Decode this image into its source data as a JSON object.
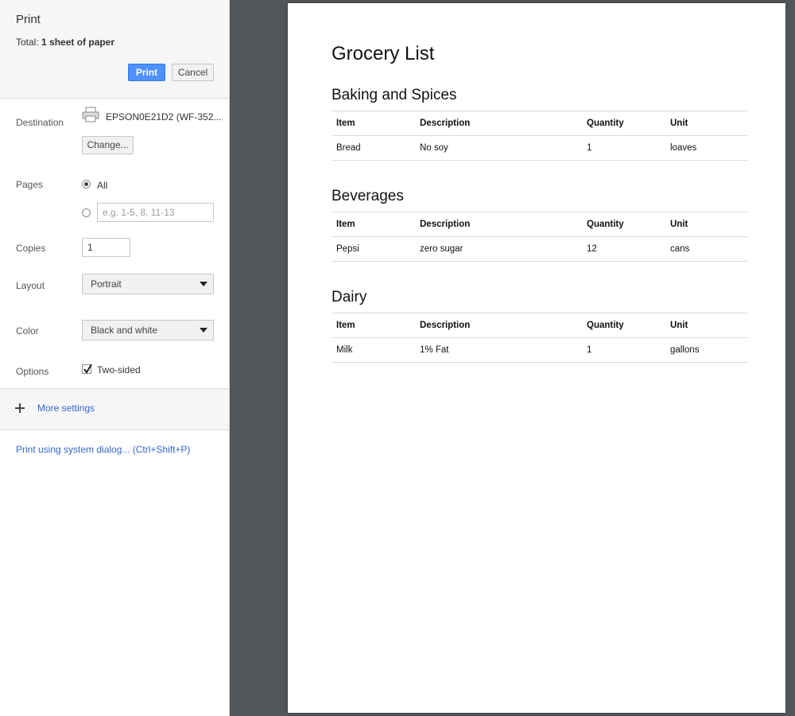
{
  "panel": {
    "title": "Print",
    "total_prefix": "Total: ",
    "total_value": "1 sheet of paper",
    "print_label": "Print",
    "cancel_label": "Cancel"
  },
  "destination": {
    "label": "Destination",
    "printer": "EPSON0E21D2 (WF-352...",
    "change_label": "Change..."
  },
  "pages": {
    "label": "Pages",
    "all_label": "All",
    "selected": "All",
    "custom_placeholder": "e.g. 1-5, 8, 11-13"
  },
  "copies": {
    "label": "Copies",
    "value": "1"
  },
  "layout": {
    "label": "Layout",
    "value": "Portrait"
  },
  "color": {
    "label": "Color",
    "value": "Black and white"
  },
  "options": {
    "label": "Options",
    "two_sided_label": "Two-sided",
    "two_sided_checked": true
  },
  "more_settings": "More settings",
  "system_dialog": "Print using system dialog... (Ctrl+Shift+P)",
  "document": {
    "title": "Grocery List",
    "columns": [
      "Item",
      "Description",
      "Quantity",
      "Unit"
    ],
    "sections": [
      {
        "name": "Baking and Spices",
        "rows": [
          [
            "Bread",
            "No soy",
            "1",
            "loaves"
          ]
        ]
      },
      {
        "name": "Beverages",
        "rows": [
          [
            "Pepsi",
            "zero sugar",
            "12",
            "cans"
          ]
        ]
      },
      {
        "name": "Dairy",
        "rows": [
          [
            "Milk",
            "1% Fat",
            "1",
            "gallons"
          ]
        ]
      }
    ]
  },
  "colors": {
    "print_button": "#4d90fe",
    "link": "#3366cc",
    "preview_background": "#525659"
  }
}
